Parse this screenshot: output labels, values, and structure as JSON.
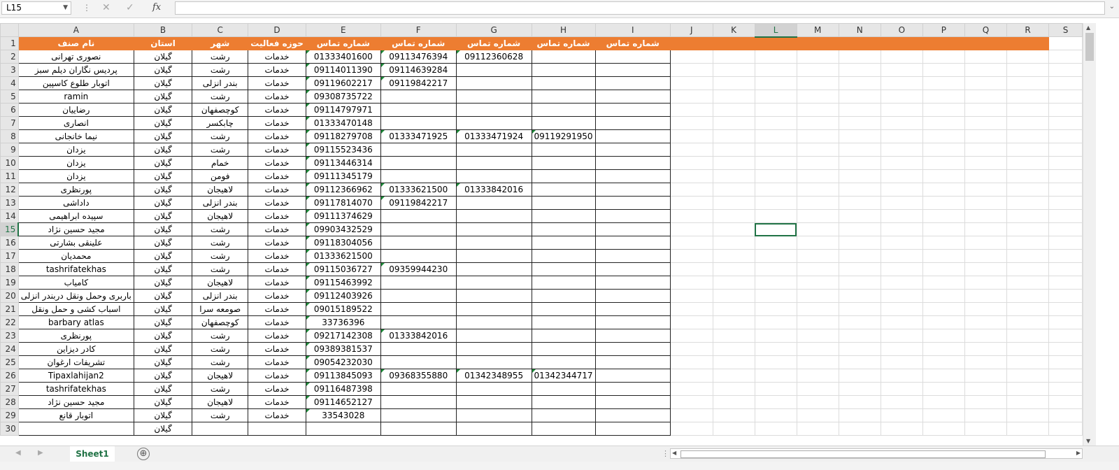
{
  "formula_bar": {
    "name_box": "L15",
    "cancel_icon": "✕",
    "enter_icon": "✓",
    "fx_label": "fx",
    "formula": ""
  },
  "columns": [
    "A",
    "B",
    "C",
    "D",
    "E",
    "F",
    "G",
    "H",
    "I",
    "J",
    "K",
    "L",
    "M",
    "N",
    "O",
    "P",
    "Q",
    "R",
    "S"
  ],
  "selected": {
    "column": "L",
    "row": 15
  },
  "header_row": {
    "row_num": 1,
    "A": "نام صنف",
    "B": "استان",
    "C": "شهر",
    "D": "حوزه فعالیت",
    "E": "شماره تماس",
    "F": "شماره تماس",
    "G": "شماره تماس",
    "H": "شماره تماس",
    "I": "شماره تماس"
  },
  "rows": [
    {
      "n": 2,
      "A": "نصوری تهرانی",
      "B": "گیلان",
      "C": "رشت",
      "D": "خدمات",
      "E": "01333401600",
      "F": "09113476394",
      "G": "09112360628",
      "H": ""
    },
    {
      "n": 3,
      "A": "پردیس نگاران دیلم سبز",
      "B": "گیلان",
      "C": "رشت",
      "D": "خدمات",
      "E": "09114011390",
      "F": "09114639284",
      "G": "",
      "H": ""
    },
    {
      "n": 4,
      "A": "اتوبار طلوع کاسپین",
      "B": "گیلان",
      "C": "بندر انزلی",
      "D": "خدمات",
      "E": "09119602217",
      "F": "09119842217",
      "G": "",
      "H": ""
    },
    {
      "n": 5,
      "A": "ramin",
      "B": "گیلان",
      "C": "رشت",
      "D": "خدمات",
      "E": "09308735722",
      "F": "",
      "G": "",
      "H": ""
    },
    {
      "n": 6,
      "A": "رضاییان",
      "B": "گیلان",
      "C": "کوچصفهان",
      "D": "خدمات",
      "E": "09114797971",
      "F": "",
      "G": "",
      "H": ""
    },
    {
      "n": 7,
      "A": "انصاری",
      "B": "گیلان",
      "C": "چابکسر",
      "D": "خدمات",
      "E": "01333470148",
      "F": "",
      "G": "",
      "H": ""
    },
    {
      "n": 8,
      "A": "نیما خانجانی",
      "B": "گیلان",
      "C": "رشت",
      "D": "خدمات",
      "E": "09118279708",
      "F": "01333471925",
      "G": "01333471924",
      "H": "09119291950"
    },
    {
      "n": 9,
      "A": "یزدان",
      "B": "گیلان",
      "C": "رشت",
      "D": "خدمات",
      "E": "09115523436",
      "F": "",
      "G": "",
      "H": ""
    },
    {
      "n": 10,
      "A": "یزدان",
      "B": "گیلان",
      "C": "خمام",
      "D": "خدمات",
      "E": "09113446314",
      "F": "",
      "G": "",
      "H": ""
    },
    {
      "n": 11,
      "A": "یزدان",
      "B": "گیلان",
      "C": "فومن",
      "D": "خدمات",
      "E": "09111345179",
      "F": "",
      "G": "",
      "H": ""
    },
    {
      "n": 12,
      "A": "پورنظری",
      "B": "گیلان",
      "C": "لاهیجان",
      "D": "خدمات",
      "E": "09112366962",
      "F": "01333621500",
      "G": "01333842016",
      "H": ""
    },
    {
      "n": 13,
      "A": "داداشی",
      "B": "گیلان",
      "C": "بندر انزلی",
      "D": "خدمات",
      "E": "09117814070",
      "F": "09119842217",
      "G": "",
      "H": ""
    },
    {
      "n": 14,
      "A": "سپیده ابراهیمی",
      "B": "گیلان",
      "C": "لاهیجان",
      "D": "خدمات",
      "E": "09111374629",
      "F": "",
      "G": "",
      "H": ""
    },
    {
      "n": 15,
      "A": "مجید حسین نژاد",
      "B": "گیلان",
      "C": "رشت",
      "D": "خدمات",
      "E": "09903432529",
      "F": "",
      "G": "",
      "H": ""
    },
    {
      "n": 16,
      "A": "علینقی  بشارتی",
      "B": "گیلان",
      "C": "رشت",
      "D": "خدمات",
      "E": "09118304056",
      "F": "",
      "G": "",
      "H": ""
    },
    {
      "n": 17,
      "A": "محمدیان",
      "B": "گیلان",
      "C": "رشت",
      "D": "خدمات",
      "E": "01333621500",
      "F": "",
      "G": "",
      "H": ""
    },
    {
      "n": 18,
      "A": "tashrifatekhas",
      "B": "گیلان",
      "C": "رشت",
      "D": "خدمات",
      "E": "09115036727",
      "F": "09359944230",
      "G": "",
      "H": ""
    },
    {
      "n": 19,
      "A": "کامیاب",
      "B": "گیلان",
      "C": "لاهیجان",
      "D": "خدمات",
      "E": "09115463992",
      "F": "",
      "G": "",
      "H": ""
    },
    {
      "n": 20,
      "A": "باربری وحمل ونقل دربندر انزلی",
      "B": "گیلان",
      "C": "بندر انزلی",
      "D": "خدمات",
      "E": "09112403926",
      "F": "",
      "G": "",
      "H": ""
    },
    {
      "n": 21,
      "A": "اسباب کشی و حمل ونقل",
      "B": "گیلان",
      "C": "صومعه سرا",
      "D": "خدمات",
      "E": "09015189522",
      "F": "",
      "G": "",
      "H": ""
    },
    {
      "n": 22,
      "A": "barbary atlas",
      "B": "گیلان",
      "C": "کوچصفهان",
      "D": "خدمات",
      "E": "33736396",
      "F": "",
      "G": "",
      "H": ""
    },
    {
      "n": 23,
      "A": "پورنظری",
      "B": "گیلان",
      "C": "رشت",
      "D": "خدمات",
      "E": "09217142308",
      "F": "01333842016",
      "G": "",
      "H": ""
    },
    {
      "n": 24,
      "A": "کادر دیزاین",
      "B": "گیلان",
      "C": "رشت",
      "D": "خدمات",
      "E": "09389381537",
      "F": "",
      "G": "",
      "H": ""
    },
    {
      "n": 25,
      "A": "تشریفات ارغوان",
      "B": "گیلان",
      "C": "رشت",
      "D": "خدمات",
      "E": "09054232030",
      "F": "",
      "G": "",
      "H": ""
    },
    {
      "n": 26,
      "A": "Tipaxlahijan2",
      "B": "گیلان",
      "C": "لاهیجان",
      "D": "خدمات",
      "E": "09113845093",
      "F": "09368355880",
      "G": "01342348955",
      "H": "01342344717"
    },
    {
      "n": 27,
      "A": "tashrifatekhas",
      "B": "گیلان",
      "C": "رشت",
      "D": "خدمات",
      "E": "09116487398",
      "F": "",
      "G": "",
      "H": ""
    },
    {
      "n": 28,
      "A": "مجید حسین نژاد",
      "B": "گیلان",
      "C": "لاهیجان",
      "D": "خدمات",
      "E": "09114652127",
      "F": "",
      "G": "",
      "H": ""
    },
    {
      "n": 29,
      "A": "اتوبار قانع",
      "B": "گیلان",
      "C": "رشت",
      "D": "خدمات",
      "E": "33543028",
      "F": "",
      "G": "",
      "H": ""
    },
    {
      "n": 30,
      "A": "",
      "B": "گیلان",
      "C": "",
      "D": "",
      "E": "",
      "F": "",
      "G": "",
      "H": ""
    }
  ],
  "sheet_tabs": {
    "active": "Sheet1",
    "add_icon": "⊕",
    "prev_icon": "◀",
    "next_icon": "▶"
  },
  "colors": {
    "header_fill": "#ed7d31",
    "accent": "#217346"
  }
}
